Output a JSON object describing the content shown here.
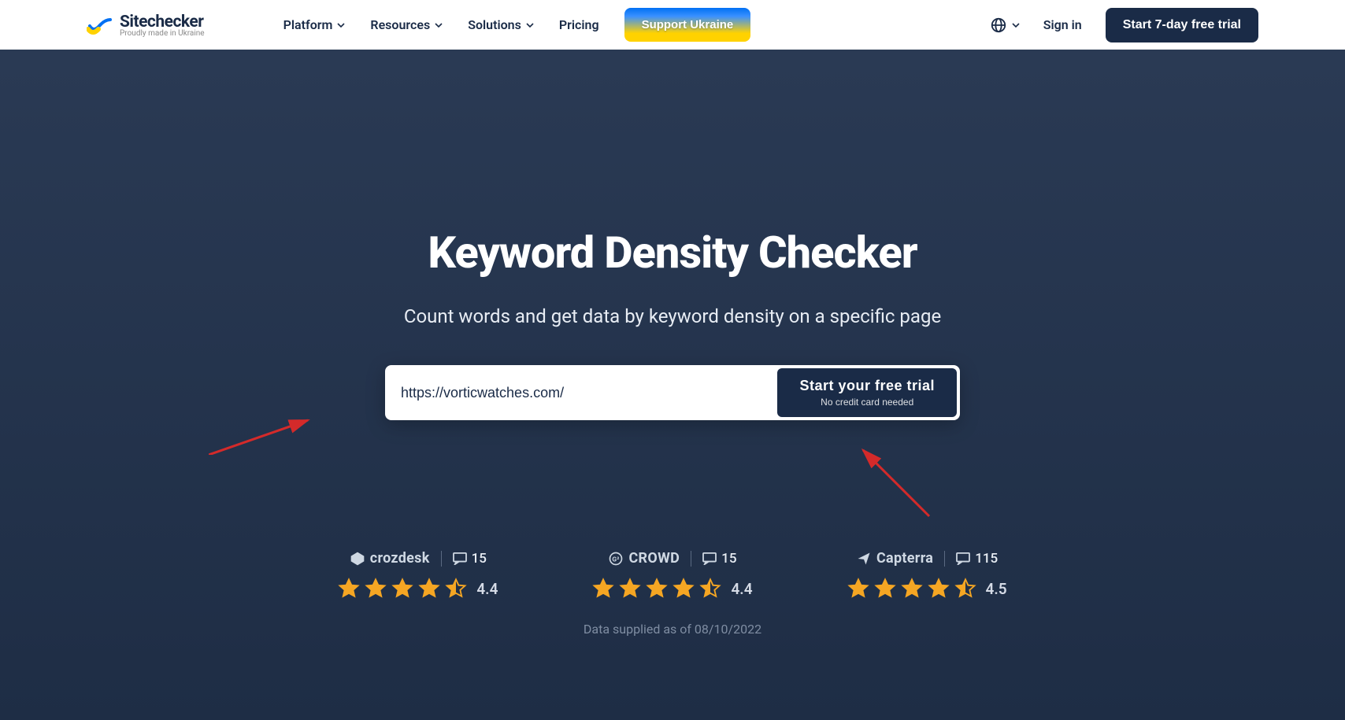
{
  "brand": {
    "name": "Sitechecker",
    "tagline": "Proudly made in Ukraine"
  },
  "nav": {
    "items": [
      {
        "label": "Platform",
        "dropdown": true
      },
      {
        "label": "Resources",
        "dropdown": true
      },
      {
        "label": "Solutions",
        "dropdown": true
      },
      {
        "label": "Pricing",
        "dropdown": false
      }
    ],
    "support_label": "Support Ukraine",
    "signin_label": "Sign in",
    "trial_label": "Start 7-day free trial"
  },
  "hero": {
    "title": "Keyword Density Checker",
    "subtitle": "Count words and get data by keyword density on a specific page",
    "input_value": "https://vorticwatches.com/",
    "cta_title": "Start your free trial",
    "cta_sub": "No credit card needed"
  },
  "ratings": [
    {
      "vendor": "crozdesk",
      "reviews": "15",
      "stars": 4.5,
      "score": "4.4"
    },
    {
      "vendor": "CROWD",
      "reviews": "15",
      "stars": 4.5,
      "score": "4.4"
    },
    {
      "vendor": "Capterra",
      "reviews": "115",
      "stars": 4.5,
      "score": "4.5"
    }
  ],
  "data_note": "Data supplied as of 08/10/2022",
  "colors": {
    "accent_star": "#f5a623",
    "arrow": "#d42a2a"
  }
}
